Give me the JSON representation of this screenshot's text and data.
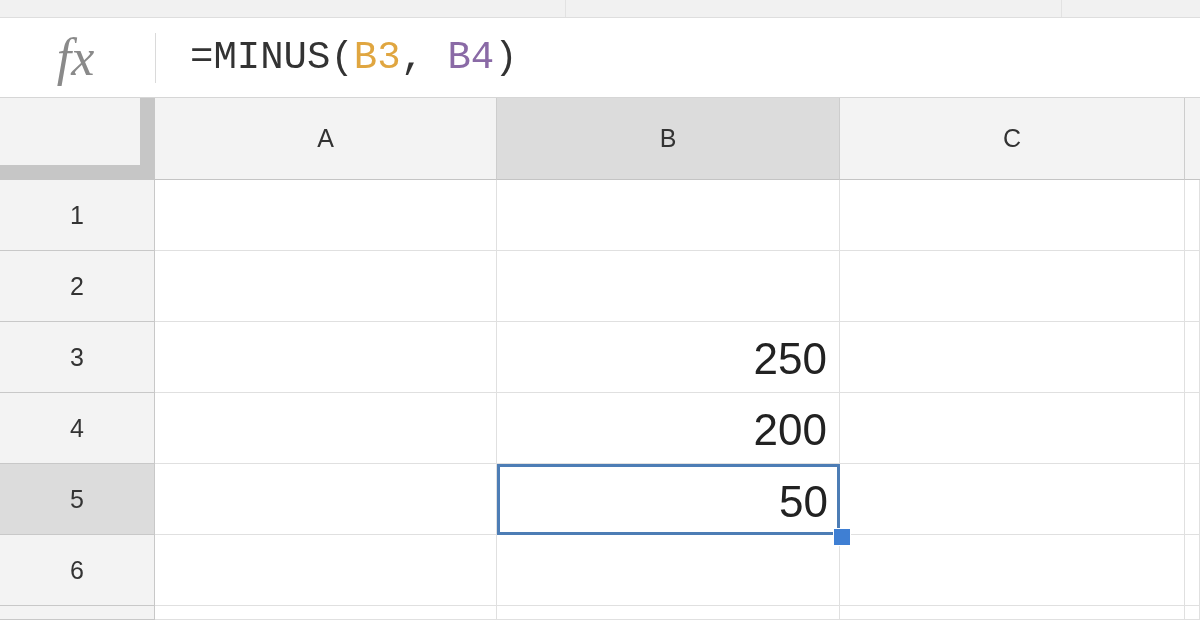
{
  "formula_bar": {
    "icon_label": "fx",
    "formula": [
      {
        "text": "=MINUS(",
        "color": "#333333"
      },
      {
        "text": "B3",
        "color": "#e0a640"
      },
      {
        "text": ", ",
        "color": "#333333"
      },
      {
        "text": "B4",
        "color": "#8a6aa6"
      },
      {
        "text": ")",
        "color": "#333333"
      }
    ]
  },
  "columns": [
    {
      "label": "A",
      "selected": false
    },
    {
      "label": "B",
      "selected": true
    },
    {
      "label": "C",
      "selected": false
    }
  ],
  "rows": [
    {
      "header": "1",
      "selected": false
    },
    {
      "header": "2",
      "selected": false
    },
    {
      "header": "3",
      "selected": false,
      "cells": {
        "B": {
          "value": "250",
          "selected": false
        }
      }
    },
    {
      "header": "4",
      "selected": false,
      "cells": {
        "B": {
          "value": "200",
          "selected": false
        }
      }
    },
    {
      "header": "5",
      "selected": true,
      "cells": {
        "B": {
          "value": "50",
          "selected": true
        }
      }
    },
    {
      "header": "6",
      "selected": false
    }
  ]
}
